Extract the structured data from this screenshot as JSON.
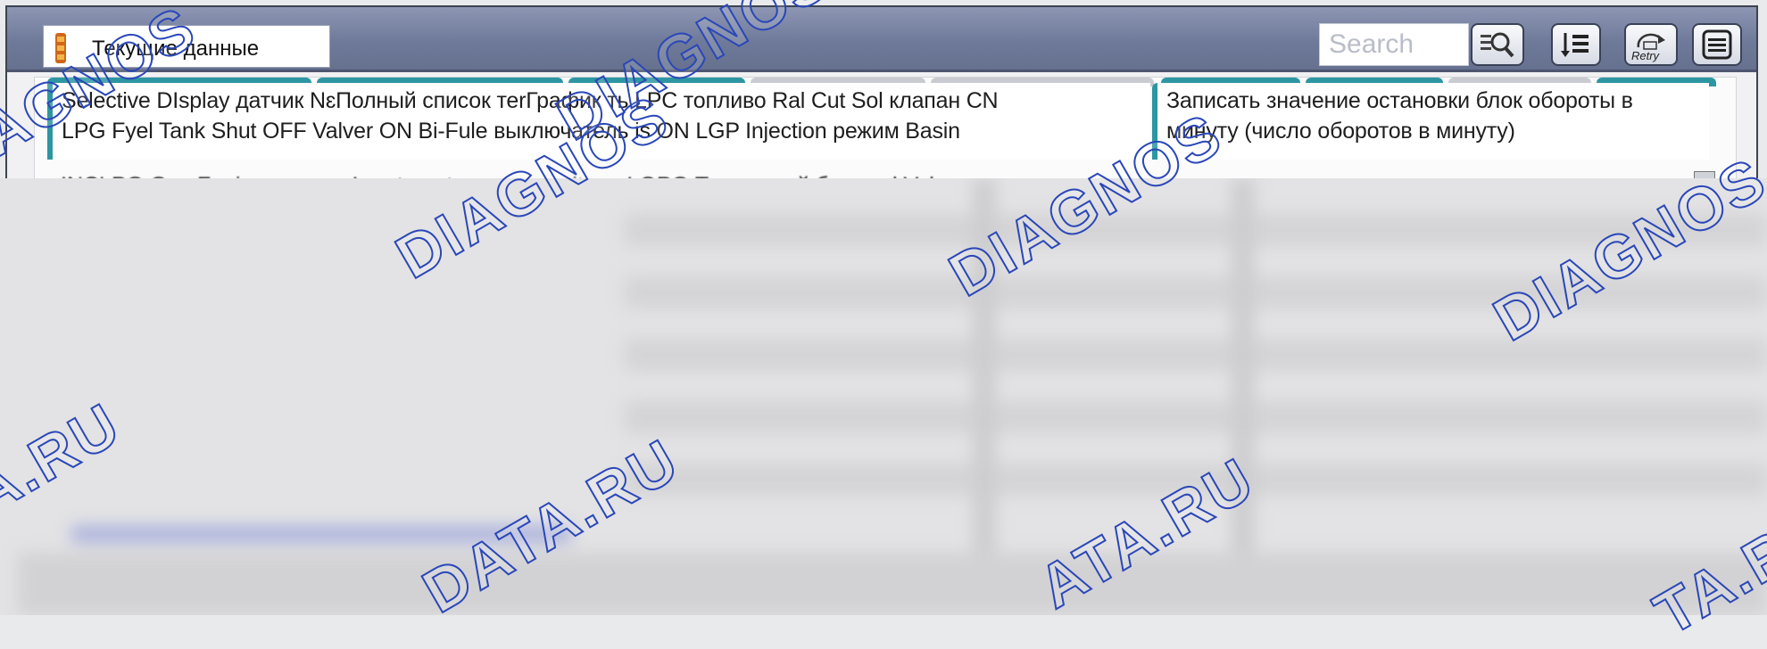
{
  "window": {
    "title": "Текущие данные",
    "search_placeholder": "Search"
  },
  "toolbar": {
    "buttons": [
      {
        "name": "search-button",
        "icon": "magnifier-list-icon"
      },
      {
        "name": "sort-list-button",
        "icon": "sorted-list-icon"
      },
      {
        "name": "retry-button",
        "icon": "retry-icon",
        "label": "Retry"
      },
      {
        "name": "menu-button",
        "icon": "hamburger-menu-icon"
      }
    ]
  },
  "content": {
    "left_line1": "Selective DIsplay датчик NɛПолный список теrГрафик  ть LPC топливо Ral Cut Sol клапан CN",
    "left_line2": "LPG Fyel Tank Shut OFF Valver ON Bi-Fule выключатель is ON LGP Injection режим Basin",
    "left_line3": "INCLPG Gas Fuei давление Lpartment уровень voitage LOPG Топливный бак evel Value",
    "right_line1": "Записать значение остановки блок обороты в",
    "right_line2": "минуту (число оборотов в минуту)"
  },
  "watermarks": [
    "DIAGNOS",
    "DIAGNOS",
    "DIAGNOS",
    "DIAGNOS",
    "DIAGNOS",
    "TA.RU",
    "DATA.RU",
    "ATA.RU",
    "TA.R"
  ],
  "colors": {
    "titlebar": "#7b85a6",
    "tab_teal": "#2d96a2",
    "watermark": "#2a47b8"
  }
}
